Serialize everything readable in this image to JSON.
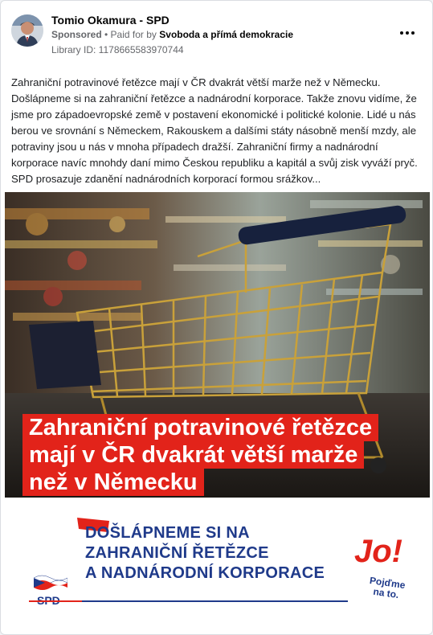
{
  "post": {
    "author": "Tomio Okamura - SPD",
    "sponsored": "Sponsored",
    "paid_for_prefix": "• Paid for by",
    "paid_for_by": "Svoboda a přímá demokracie",
    "library_id": "Library ID: 1178665583970744",
    "body_text": "Zahraniční potravinové řetězce mají v ČR dvakrát větší marže než v Německu. Došlápneme si na zahraniční řetězce a nadnárodní korporace. Takže znovu vidíme, že jsme pro západoevropské země v postavení ekonomické i politické kolonie. Lidé u nás berou ve srovnání s Německem, Rakouskem a dalšími státy násobně menší mzdy, ale potraviny jsou u nás v mnoha případech dražší. Zahraniční firmy a nadnárodní korporace navíc mnohdy daní mimo Českou republiku a kapitál a svůj zisk vyváží pryč. SPD prosazuje zdanění nadnárodních korporací formou srážkov..."
  },
  "creative": {
    "headline_lines": [
      "Zahraniční potravinové řetězce",
      "mají v ČR dvakrát větší marže",
      "než v Německu"
    ],
    "slogan_lines": [
      "DOŠLÁPNEME SI NA",
      "ZAHRANIČNÍ ŘETĚZCE",
      "A NADNÁRODNÍ KORPORACE"
    ],
    "party_logo": "SPD",
    "jo_mark": "Jo!",
    "tagline_lines": [
      "Pojďme",
      "na to."
    ]
  },
  "colors": {
    "brand_red": "#e2231a",
    "brand_blue": "#1f3a8a",
    "muted_text": "#65676b"
  },
  "icons": {
    "more": "more-horizontal-icon"
  }
}
